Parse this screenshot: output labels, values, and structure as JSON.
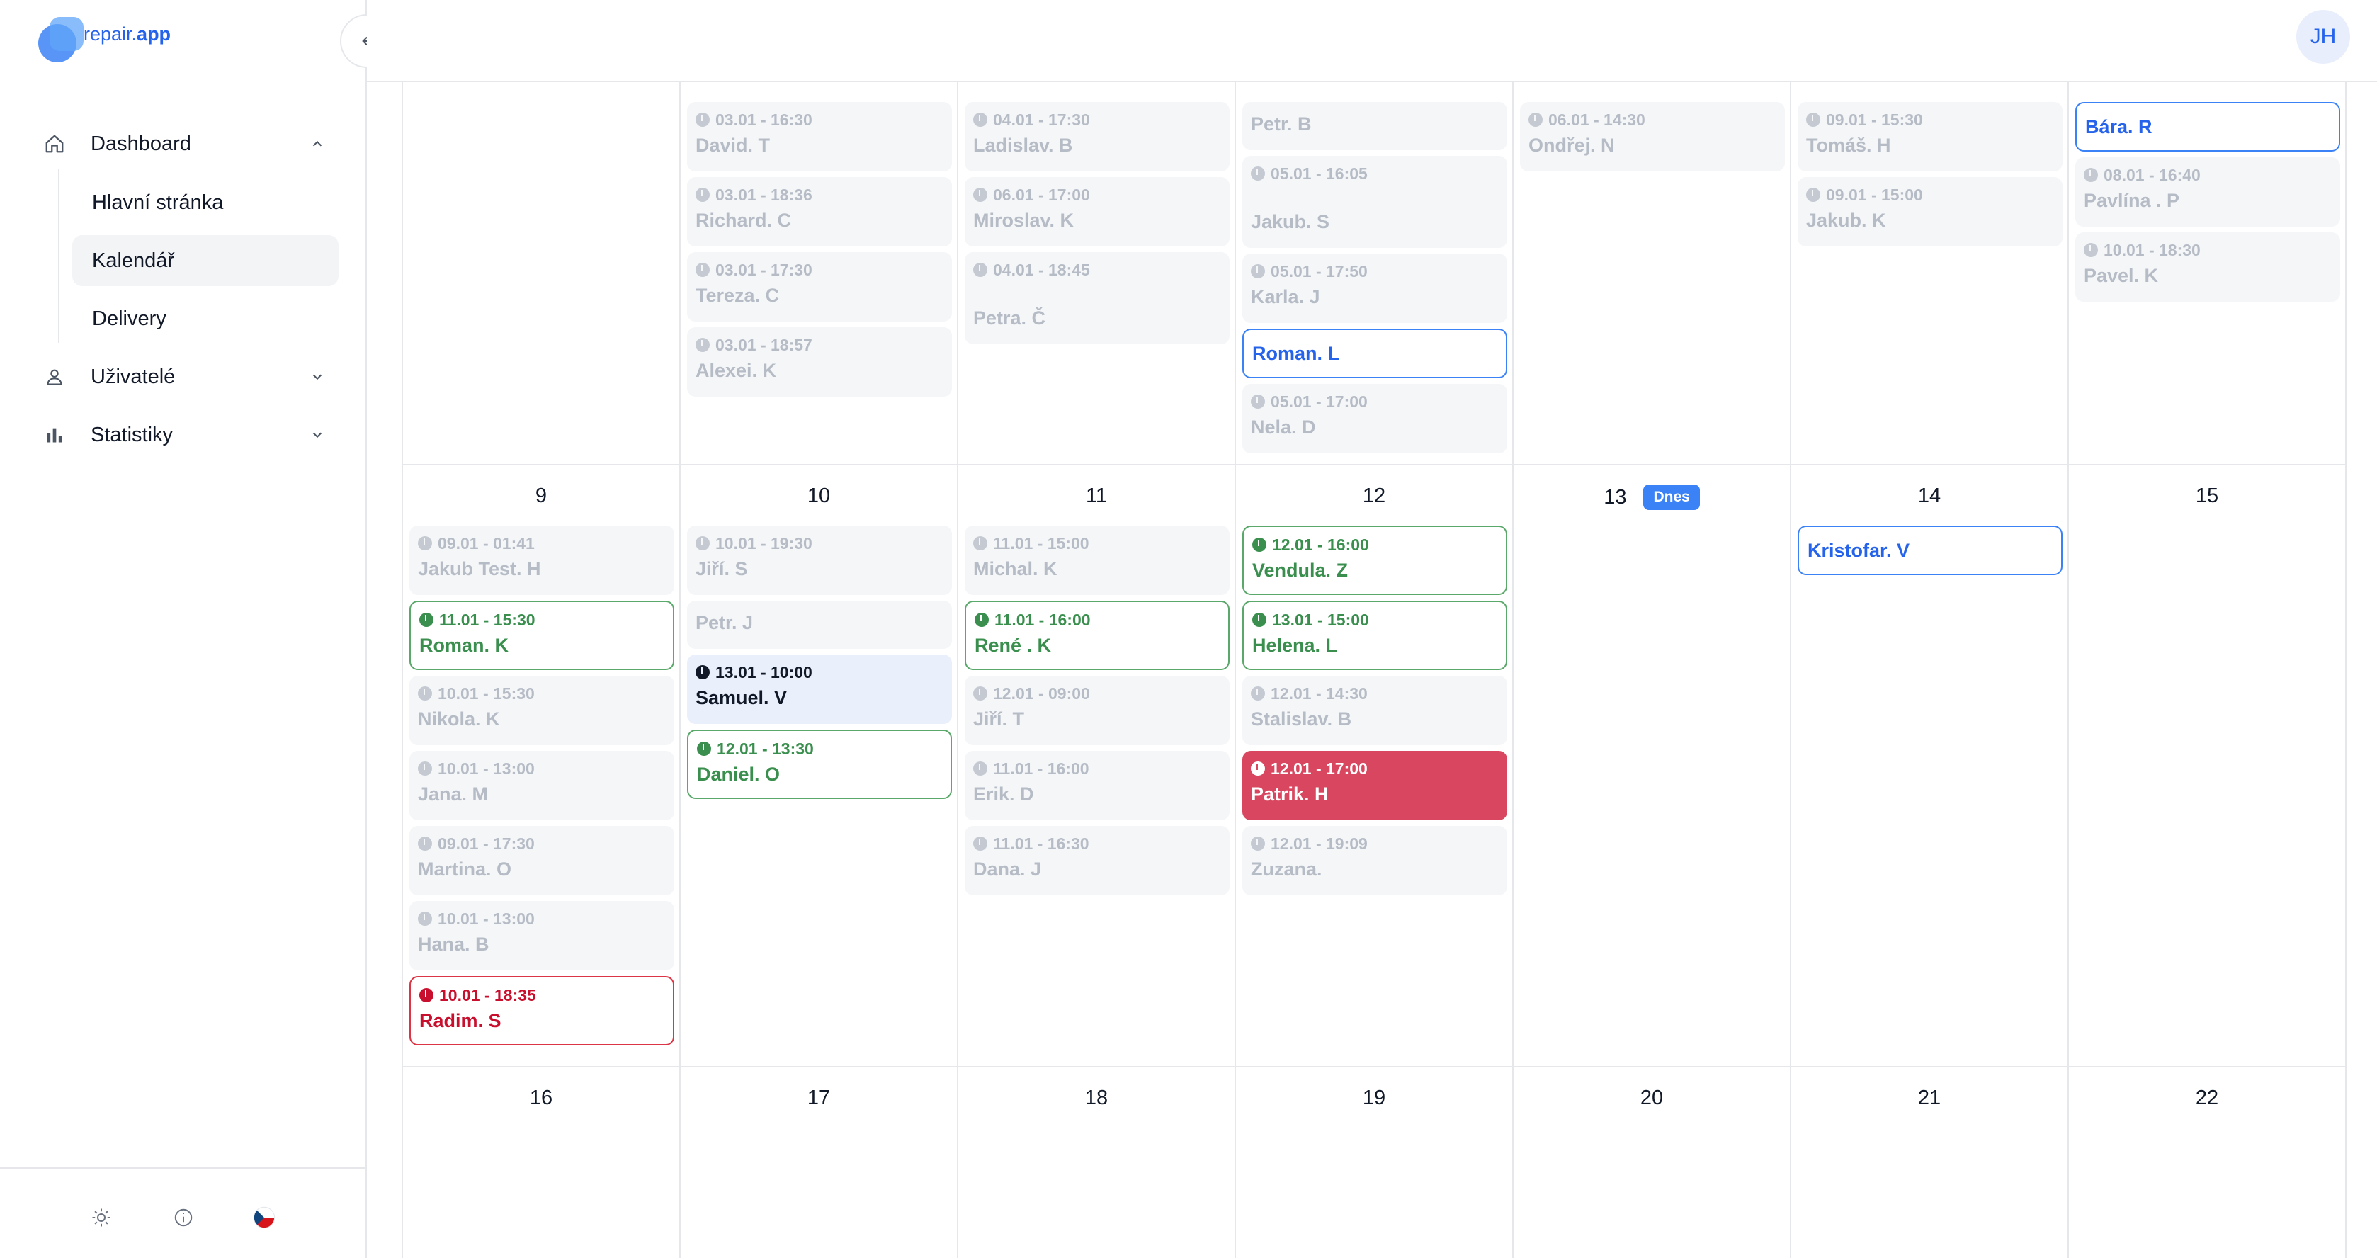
{
  "app": {
    "name_prefix": "repair.",
    "name_suffix": "app",
    "user_initials": "JH"
  },
  "colors": {
    "accent": "#3b82f6",
    "green": "#3a8f4e",
    "red": "#c8102e",
    "red_fill": "#d9465f",
    "muted": "#b6bcc6"
  },
  "sidebar": {
    "dashboard": {
      "label": "Dashboard",
      "icon": "home-icon",
      "expanded": true
    },
    "sub_items": [
      {
        "label": "Hlavní stránka",
        "active": false
      },
      {
        "label": "Kalendář",
        "active": true
      },
      {
        "label": "Delivery",
        "active": false
      }
    ],
    "users": {
      "label": "Uživatelé",
      "icon": "user-icon"
    },
    "stats": {
      "label": "Statistiky",
      "icon": "bar-chart-icon"
    },
    "footer": {
      "theme_icon": "sun-icon",
      "info_icon": "info-icon",
      "language_icon": "czech-flag-icon"
    }
  },
  "calendar": {
    "today_label": "Dnes",
    "week1": {
      "days": [
        "",
        "",
        "",
        "",
        "",
        "",
        ""
      ],
      "cells": [
        [],
        [
          {
            "time": "03.01 - 16:30",
            "name": "David. T",
            "status": "past"
          },
          {
            "time": "03.01 - 18:36",
            "name": "Richard. C",
            "status": "past"
          },
          {
            "time": "03.01 - 17:30",
            "name": "Tereza. C",
            "status": "past"
          },
          {
            "time": "03.01 - 18:57",
            "name": "Alexei. K",
            "status": "past"
          }
        ],
        [
          {
            "time": "04.01 - 17:30",
            "name": "Ladislav. B",
            "status": "past"
          },
          {
            "time": "06.01 - 17:00",
            "name": "Miroslav. K",
            "status": "past"
          },
          {
            "time": "04.01 - 18:45",
            "name": "Petra. Č",
            "status": "past"
          }
        ],
        [
          {
            "time": "",
            "name": "Petr. B",
            "status": "past"
          },
          {
            "time": "05.01 - 16:05",
            "name": "Jakub. S",
            "status": "past"
          },
          {
            "time": "05.01 - 17:50",
            "name": "Karla. J",
            "status": "past"
          },
          {
            "time": "",
            "name": "Roman. L",
            "status": "blue"
          },
          {
            "time": "05.01 - 17:00",
            "name": "Nela. D",
            "status": "past"
          }
        ],
        [
          {
            "time": "06.01 - 14:30",
            "name": "Ondřej. N",
            "status": "past"
          }
        ],
        [
          {
            "time": "09.01 - 15:30",
            "name": "Tomáš. H",
            "status": "past"
          },
          {
            "time": "09.01 - 15:00",
            "name": "Jakub. K",
            "status": "past"
          }
        ],
        [
          {
            "time": "",
            "name": "Bára. R",
            "status": "blue"
          },
          {
            "time": "08.01 - 16:40",
            "name": "Pavlína . P",
            "status": "past"
          },
          {
            "time": "10.01 - 18:30",
            "name": "Pavel. K",
            "status": "past"
          }
        ]
      ]
    },
    "week2": {
      "days": [
        "9",
        "10",
        "11",
        "12",
        "13",
        "14",
        "15"
      ],
      "cells": [
        [
          {
            "time": "09.01 - 01:41",
            "name": "Jakub Test. H",
            "status": "past"
          },
          {
            "time": "11.01 - 15:30",
            "name": "Roman. K",
            "status": "green"
          },
          {
            "time": "10.01 - 15:30",
            "name": "Nikola. K",
            "status": "past"
          },
          {
            "time": "10.01 - 13:00",
            "name": "Jana. M",
            "status": "past"
          },
          {
            "time": "09.01 - 17:30",
            "name": "Martina. O",
            "status": "past"
          },
          {
            "time": "10.01 - 13:00",
            "name": "Hana. B",
            "status": "past"
          },
          {
            "time": "10.01 - 18:35",
            "name": "Radim. S",
            "status": "red"
          }
        ],
        [
          {
            "time": "10.01 - 19:30",
            "name": "Jiří. S",
            "status": "past"
          },
          {
            "time": "",
            "name": "Petr. J",
            "status": "past"
          },
          {
            "time": "13.01 - 10:00",
            "name": "Samuel. V",
            "status": "cur"
          },
          {
            "time": "12.01 - 13:30",
            "name": "Daniel. O",
            "status": "green"
          }
        ],
        [
          {
            "time": "11.01 - 15:00",
            "name": "Michal. K",
            "status": "past"
          },
          {
            "time": "11.01 - 16:00",
            "name": "René . K",
            "status": "green"
          },
          {
            "time": "12.01 - 09:00",
            "name": "Jiří. T",
            "status": "past"
          },
          {
            "time": "11.01 - 16:00",
            "name": "Erik. D",
            "status": "past"
          },
          {
            "time": "11.01 - 16:30",
            "name": "Dana. J",
            "status": "past"
          }
        ],
        [
          {
            "time": "12.01 - 16:00",
            "name": "Vendula. Z",
            "status": "green"
          },
          {
            "time": "13.01 - 15:00",
            "name": "Helena. L",
            "status": "green"
          },
          {
            "time": "12.01 - 14:30",
            "name": "Stalislav. B",
            "status": "past"
          },
          {
            "time": "12.01 - 17:00",
            "name": "Patrik. H",
            "status": "redfill"
          },
          {
            "time": "12.01 - 19:09",
            "name": "Zuzana.",
            "status": "past"
          }
        ],
        [],
        [
          {
            "time": "",
            "name": "Kristofar. V",
            "status": "blue"
          }
        ],
        []
      ]
    },
    "week3": {
      "days": [
        "16",
        "17",
        "18",
        "19",
        "20",
        "21",
        "22"
      ]
    }
  }
}
